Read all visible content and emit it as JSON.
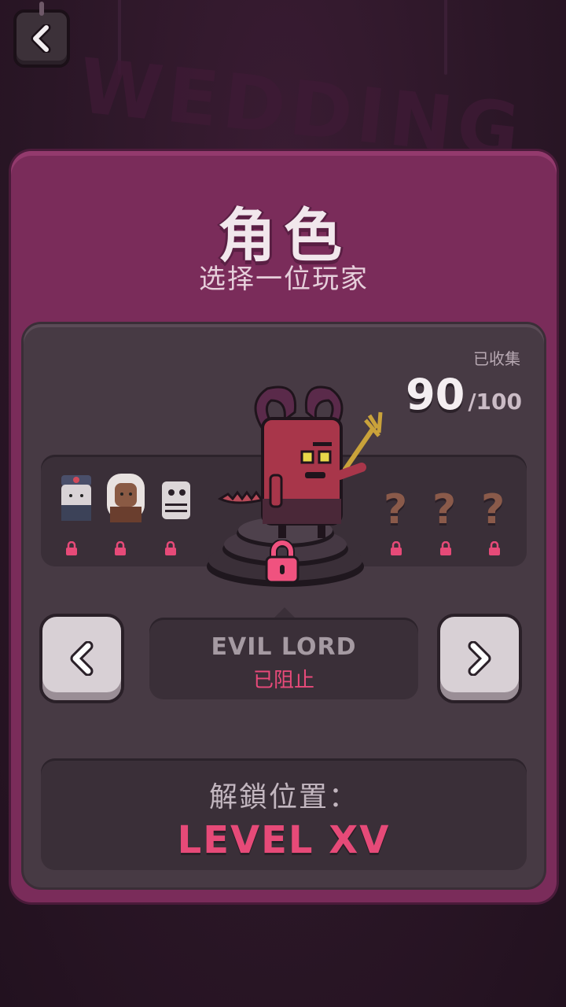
{
  "background": {
    "banner_text": "WEDDING"
  },
  "header": {
    "back_icon": "chevron-left-icon"
  },
  "panel": {
    "title": "角色",
    "subtitle": "选择一位玩家"
  },
  "collection": {
    "label": "已收集",
    "count": "90",
    "total": "/100"
  },
  "carousel": {
    "characters_left": [
      "police-character",
      "eskimo-character",
      "skeleton-character"
    ],
    "characters_right": [
      "unknown",
      "unknown",
      "unknown"
    ],
    "unknown_glyph": "?",
    "selected_character": "evil-lord-character"
  },
  "selection": {
    "name": "EVIL LORD",
    "status": "已阻止"
  },
  "unlock": {
    "label": "解鎖位置：",
    "level": "LEVEL XV"
  },
  "colors": {
    "panel": "#7a2c5a",
    "inner": "#473a44",
    "accent_pink": "#e64a78"
  }
}
